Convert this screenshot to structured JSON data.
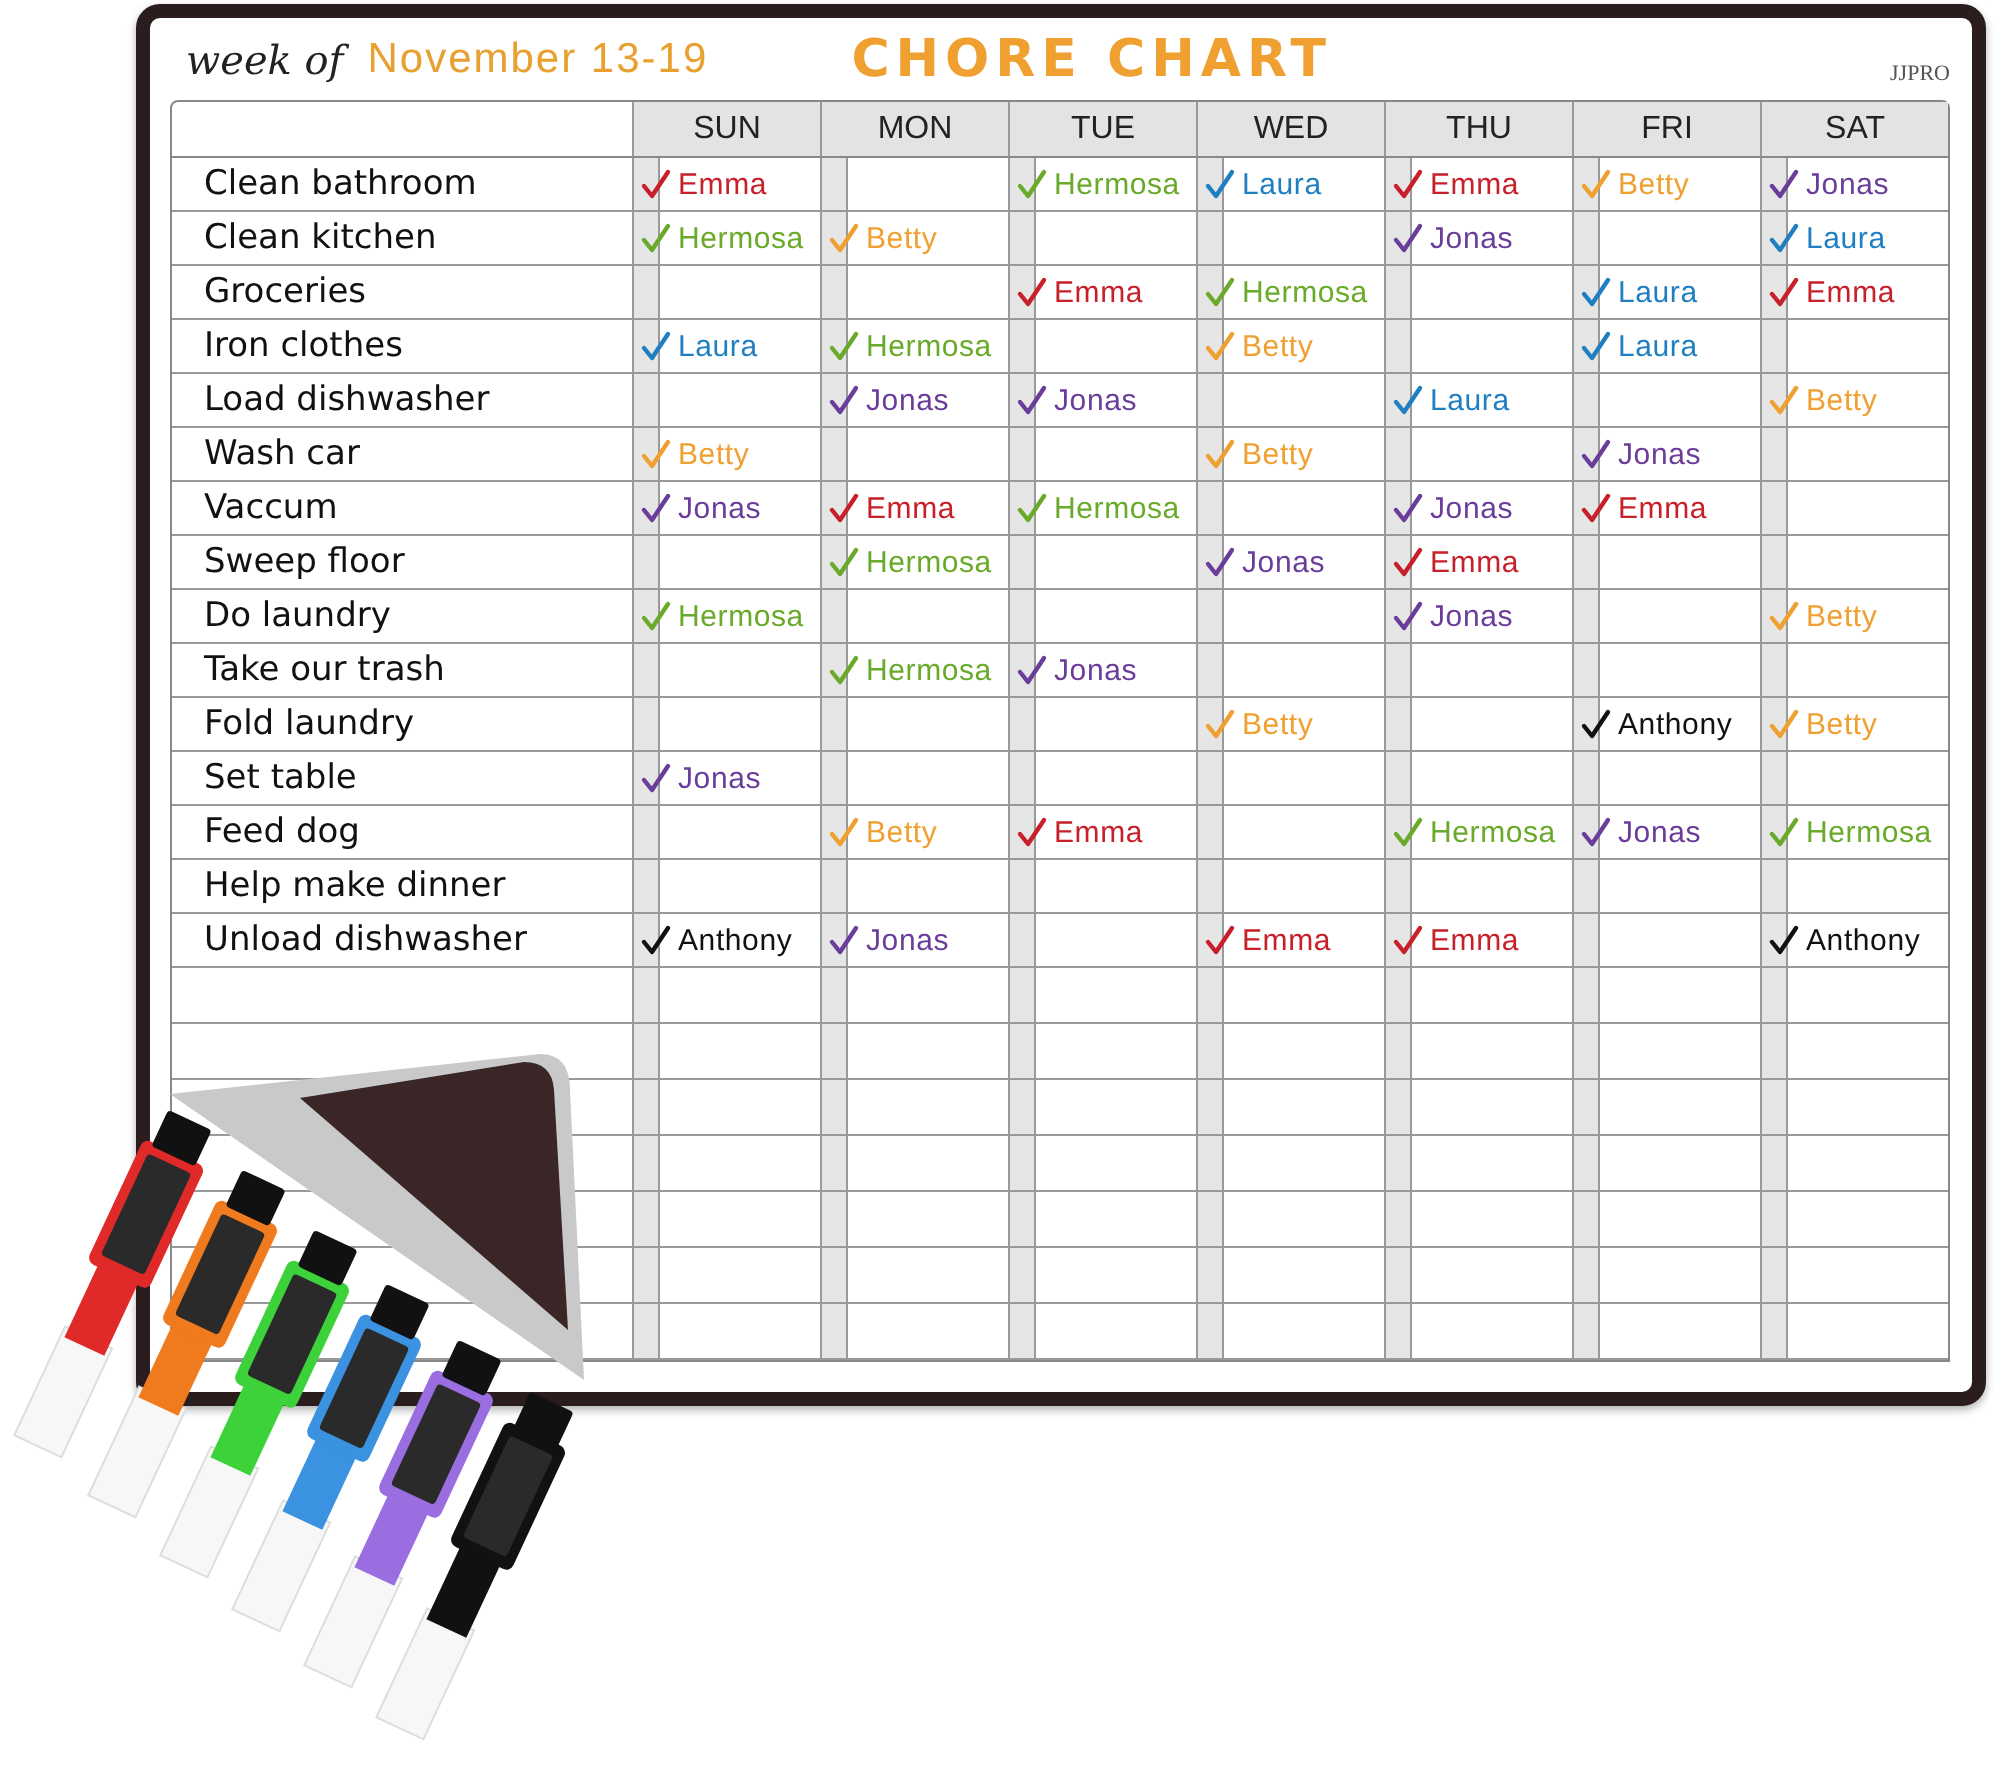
{
  "header": {
    "week_label": "week of",
    "week": "November 13-19",
    "title": "CHORE CHART",
    "brand": "JJPRO"
  },
  "days": [
    "SUN",
    "MON",
    "TUE",
    "WED",
    "THU",
    "FRI",
    "SAT"
  ],
  "rows": [
    {
      "chore": "Clean bathroom",
      "cells": [
        {
          "name": "Emma",
          "color": "#c8202a"
        },
        null,
        {
          "name": "Hermosa",
          "color": "#6aaa2a"
        },
        {
          "name": "Laura",
          "color": "#1f7fc0"
        },
        {
          "name": "Emma",
          "color": "#c8202a"
        },
        {
          "name": "Betty",
          "color": "#f0a030"
        },
        {
          "name": "Jonas",
          "color": "#6a3d9a"
        }
      ]
    },
    {
      "chore": "Clean kitchen",
      "cells": [
        {
          "name": "Hermosa",
          "color": "#6aaa2a"
        },
        {
          "name": "Betty",
          "color": "#f0a030"
        },
        null,
        null,
        {
          "name": "Jonas",
          "color": "#6a3d9a"
        },
        null,
        {
          "name": "Laura",
          "color": "#1f7fc0"
        }
      ]
    },
    {
      "chore": "Groceries",
      "cells": [
        null,
        null,
        {
          "name": "Emma",
          "color": "#c8202a"
        },
        {
          "name": "Hermosa",
          "color": "#6aaa2a"
        },
        null,
        {
          "name": "Laura",
          "color": "#1f7fc0"
        },
        {
          "name": "Emma",
          "color": "#c8202a"
        }
      ]
    },
    {
      "chore": "Iron clothes",
      "cells": [
        {
          "name": "Laura",
          "color": "#1f7fc0"
        },
        {
          "name": "Hermosa",
          "color": "#6aaa2a"
        },
        null,
        {
          "name": "Betty",
          "color": "#f0a030"
        },
        null,
        {
          "name": "Laura",
          "color": "#1f7fc0"
        },
        null
      ]
    },
    {
      "chore": "Load dishwasher",
      "cells": [
        null,
        {
          "name": "Jonas",
          "color": "#6a3d9a"
        },
        {
          "name": "Jonas",
          "color": "#6a3d9a"
        },
        null,
        {
          "name": "Laura",
          "color": "#1f7fc0"
        },
        null,
        {
          "name": "Betty",
          "color": "#f0a030"
        }
      ]
    },
    {
      "chore": "Wash car",
      "cells": [
        {
          "name": "Betty",
          "color": "#f0a030"
        },
        null,
        null,
        {
          "name": "Betty",
          "color": "#f0a030"
        },
        null,
        {
          "name": "Jonas",
          "color": "#6a3d9a"
        },
        null
      ]
    },
    {
      "chore": "Vaccum",
      "cells": [
        {
          "name": "Jonas",
          "color": "#6a3d9a"
        },
        {
          "name": "Emma",
          "color": "#c8202a"
        },
        {
          "name": "Hermosa",
          "color": "#6aaa2a"
        },
        null,
        {
          "name": "Jonas",
          "color": "#6a3d9a"
        },
        {
          "name": "Emma",
          "color": "#c8202a"
        },
        null
      ]
    },
    {
      "chore": "Sweep floor",
      "cells": [
        null,
        {
          "name": "Hermosa",
          "color": "#6aaa2a"
        },
        null,
        {
          "name": "Jonas",
          "color": "#6a3d9a"
        },
        {
          "name": "Emma",
          "color": "#c8202a"
        },
        null,
        null
      ]
    },
    {
      "chore": "Do laundry",
      "cells": [
        {
          "name": "Hermosa",
          "color": "#6aaa2a"
        },
        null,
        null,
        null,
        {
          "name": "Jonas",
          "color": "#6a3d9a"
        },
        null,
        {
          "name": "Betty",
          "color": "#f0a030"
        }
      ]
    },
    {
      "chore": "Take our trash",
      "cells": [
        null,
        {
          "name": "Hermosa",
          "color": "#6aaa2a"
        },
        {
          "name": "Jonas",
          "color": "#6a3d9a"
        },
        null,
        null,
        null,
        null
      ]
    },
    {
      "chore": "Fold laundry",
      "cells": [
        null,
        null,
        null,
        {
          "name": "Betty",
          "color": "#f0a030"
        },
        null,
        {
          "name": "Anthony",
          "color": "#111111"
        },
        {
          "name": "Betty",
          "color": "#f0a030"
        }
      ]
    },
    {
      "chore": "Set table",
      "cells": [
        {
          "name": "Jonas",
          "color": "#6a3d9a"
        },
        null,
        null,
        null,
        null,
        null,
        null
      ]
    },
    {
      "chore": "Feed dog",
      "cells": [
        null,
        {
          "name": "Betty",
          "color": "#f0a030"
        },
        {
          "name": "Emma",
          "color": "#c8202a"
        },
        null,
        {
          "name": "Hermosa",
          "color": "#6aaa2a"
        },
        {
          "name": "Jonas",
          "color": "#6a3d9a"
        },
        {
          "name": "Hermosa",
          "color": "#6aaa2a"
        }
      ]
    },
    {
      "chore": "Help make dinner",
      "cells": [
        null,
        null,
        null,
        null,
        null,
        null,
        null
      ]
    },
    {
      "chore": "Unload dishwasher",
      "cells": [
        {
          "name": "Anthony",
          "color": "#111111"
        },
        {
          "name": "Jonas",
          "color": "#6a3d9a"
        },
        null,
        {
          "name": "Emma",
          "color": "#c8202a"
        },
        {
          "name": "Emma",
          "color": "#c8202a"
        },
        null,
        {
          "name": "Anthony",
          "color": "#111111"
        }
      ]
    }
  ]
}
